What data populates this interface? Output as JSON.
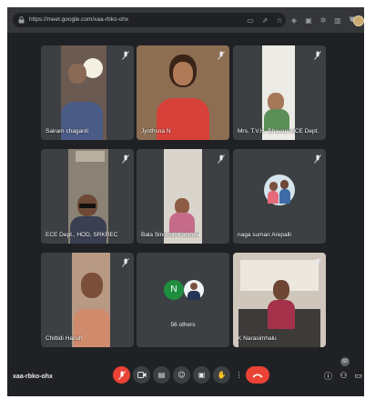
{
  "browser": {
    "url": "https://meet.google.com/xaa-rbko-ohx"
  },
  "participants": [
    {
      "name": "Sairam chaganti"
    },
    {
      "name": "Jyothsna N"
    },
    {
      "name": "Mrs. T.V.H. Bhavani ECE Dept."
    },
    {
      "name": "ECE Dept., HOD, SRKREC"
    },
    {
      "name": "Bala Sindhuri Kandula"
    },
    {
      "name": "naga suman Arepalli"
    },
    {
      "name": "Chittidi Harish"
    },
    {
      "name": "56 others",
      "avatar_letter": "N"
    },
    {
      "name": "K Narasimhalu"
    }
  ],
  "bottom_bar": {
    "meeting_code": "xaa-rbko-ohx",
    "participant_count": "60"
  },
  "colors": {
    "background": "#202124",
    "tile": "#3c4043",
    "end_call": "#ea4335",
    "avatar_n": "#1e8e3e"
  },
  "icons": [
    "lock-icon",
    "mic-off-icon",
    "camera-icon",
    "captions-icon",
    "emoji-icon",
    "present-icon",
    "raise-hand-icon",
    "more-icon",
    "end-call-icon",
    "info-icon",
    "people-icon",
    "chat-icon"
  ]
}
